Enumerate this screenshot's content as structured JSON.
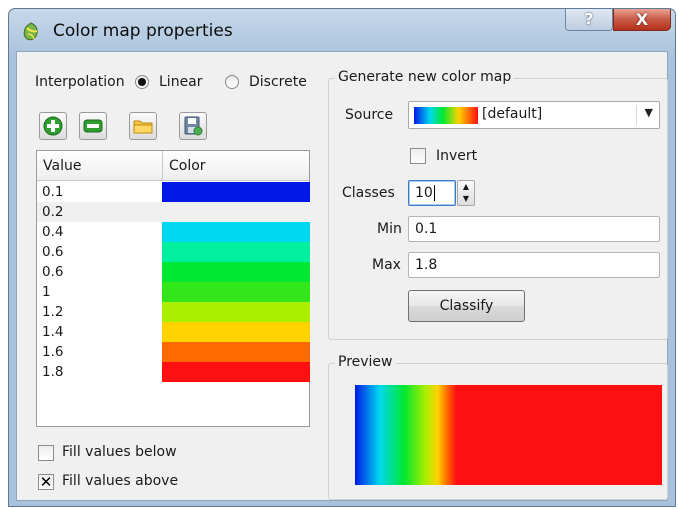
{
  "window": {
    "title": "Color map properties",
    "help_glyph": "?",
    "close_glyph": "X"
  },
  "interpolation": {
    "label": "Interpolation",
    "options": [
      "Linear",
      "Discrete"
    ],
    "selected": "Linear"
  },
  "toolbar": {
    "icons": [
      "add-entry-icon",
      "remove-entry-icon",
      "load-folder-icon",
      "export-icon"
    ]
  },
  "table": {
    "headers": [
      "Value",
      "Color"
    ],
    "rows": [
      {
        "value": "0.1",
        "color": "#0018e6"
      },
      {
        "value": "0.2",
        "color": ""
      },
      {
        "value": "0.4",
        "color": "#00d8f0"
      },
      {
        "value": "0.6",
        "color": "#00f0a0"
      },
      {
        "value": "0.6",
        "color": "#00e830"
      },
      {
        "value": "1",
        "color": "#33e61a"
      },
      {
        "value": "1.2",
        "color": "#aaee00"
      },
      {
        "value": "1.4",
        "color": "#ffd200"
      },
      {
        "value": "1.6",
        "color": "#ff6a00"
      },
      {
        "value": "1.8",
        "color": "#ff1010"
      }
    ]
  },
  "fill_below": {
    "label": "Fill values below",
    "checked": false
  },
  "fill_above": {
    "label": "Fill values above",
    "checked": true
  },
  "generate": {
    "title": "Generate new color map",
    "source_label": "Source",
    "source_value": "[default]",
    "invert_label": "Invert",
    "invert_checked": false,
    "classes_label": "Classes",
    "classes_value": "10",
    "min_label": "Min",
    "min_value": "0.1",
    "max_label": "Max",
    "max_value": "1.8",
    "classify_label": "Classify"
  },
  "preview": {
    "title": "Preview"
  },
  "colors": {
    "blue": "#0018e6",
    "cyan": "#00d8f0",
    "green": "#00e830",
    "yellow": "#ffd200",
    "orange": "#ff6a00",
    "red": "#ff1010"
  }
}
